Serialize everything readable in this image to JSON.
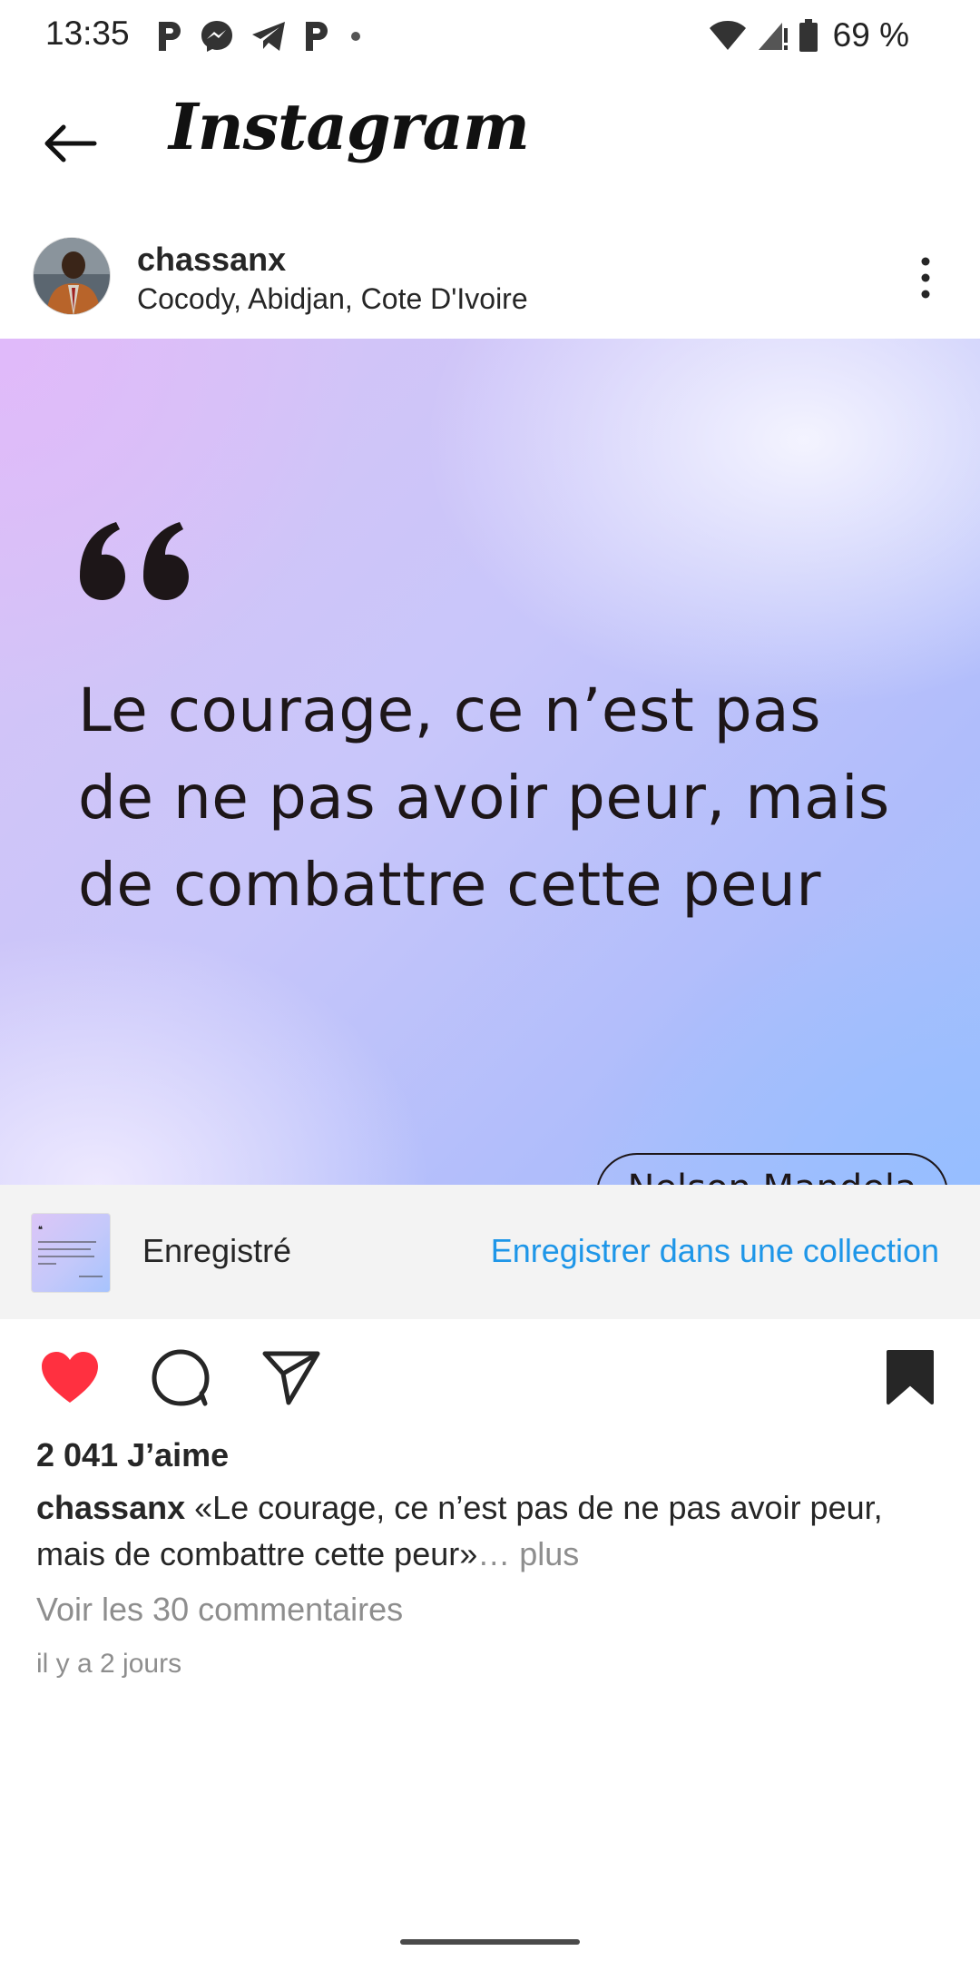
{
  "status_bar": {
    "time": "13:35",
    "notification_icons": [
      "p-icon",
      "messenger-icon",
      "telegram-icon",
      "p-icon",
      "dot-icon"
    ],
    "battery": "69 %"
  },
  "header": {
    "logo": "Instagram"
  },
  "post": {
    "username": "chassanx",
    "location": "Cocody, Abidjan, Cote D'Ivoire",
    "quote_text": "Le courage, ce n’est pas de ne pas avoir peur, mais de combattre cette peur",
    "author": "Nelson Mandela"
  },
  "saved_bar": {
    "status": "Enregistré",
    "link": "Enregistrer dans une collection",
    "link_color": "#1e96e8"
  },
  "actions": {
    "liked": true,
    "saved": true,
    "like_color": "#ff3040"
  },
  "meta": {
    "likes": "2 041 J’aime",
    "caption_user": "chassanx",
    "caption_text": " «Le courage, ce n’est pas de ne pas avoir peur, mais de combattre cette peur»",
    "caption_more": "… plus",
    "comments_link": "Voir les 30 commentaires",
    "timestamp": "il y a 2 jours"
  }
}
